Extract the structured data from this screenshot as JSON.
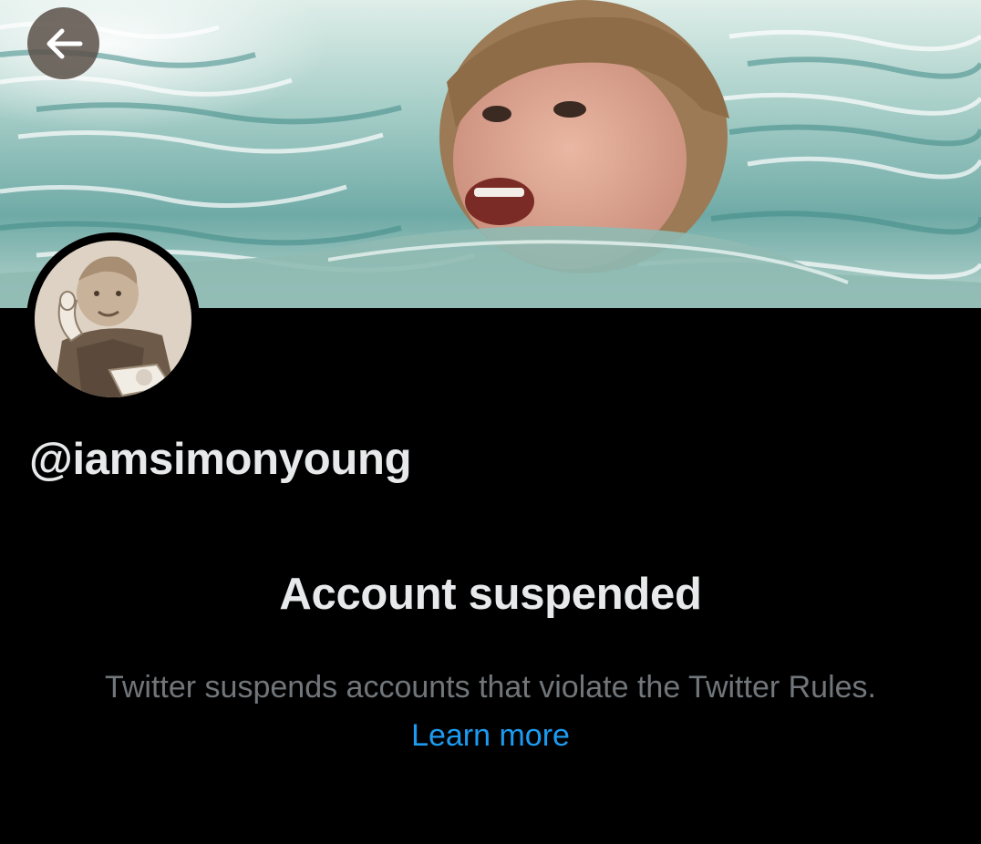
{
  "profile": {
    "handle": "@iamsimonyoung"
  },
  "suspension": {
    "title": "Account suspended",
    "description_part1": "Twitter suspends accounts that violate the Twitter Rules.",
    "learn_more_label": "Learn more"
  },
  "icons": {
    "back": "arrow-left-icon"
  },
  "colors": {
    "background": "#000000",
    "primary_text": "#e7e9ea",
    "secondary_text": "#71767b",
    "link": "#1d9bf0",
    "back_button_bg": "#5a5048"
  }
}
